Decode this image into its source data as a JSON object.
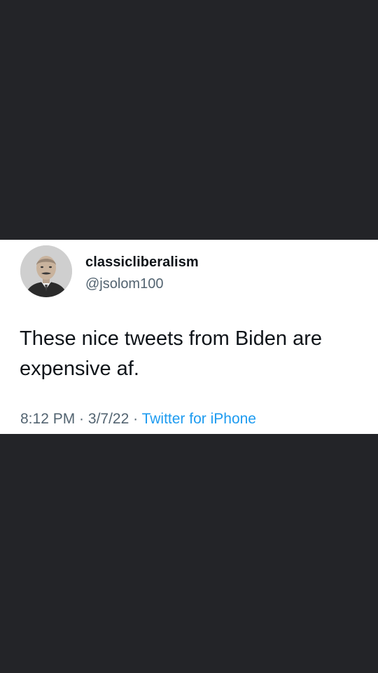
{
  "tweet": {
    "display_name": "classicliberalism",
    "handle": "@jsolom100",
    "text": "These nice tweets from Biden are expensive af.",
    "time": "8:12 PM",
    "separator": " · ",
    "date": "3/7/22",
    "source": "Twitter for iPhone",
    "avatar_icon": "portrait-photo-icon"
  },
  "colors": {
    "background": "#232428",
    "card": "#ffffff",
    "text_primary": "#0f1419",
    "text_secondary": "#536471",
    "link": "#1d9bf0"
  }
}
